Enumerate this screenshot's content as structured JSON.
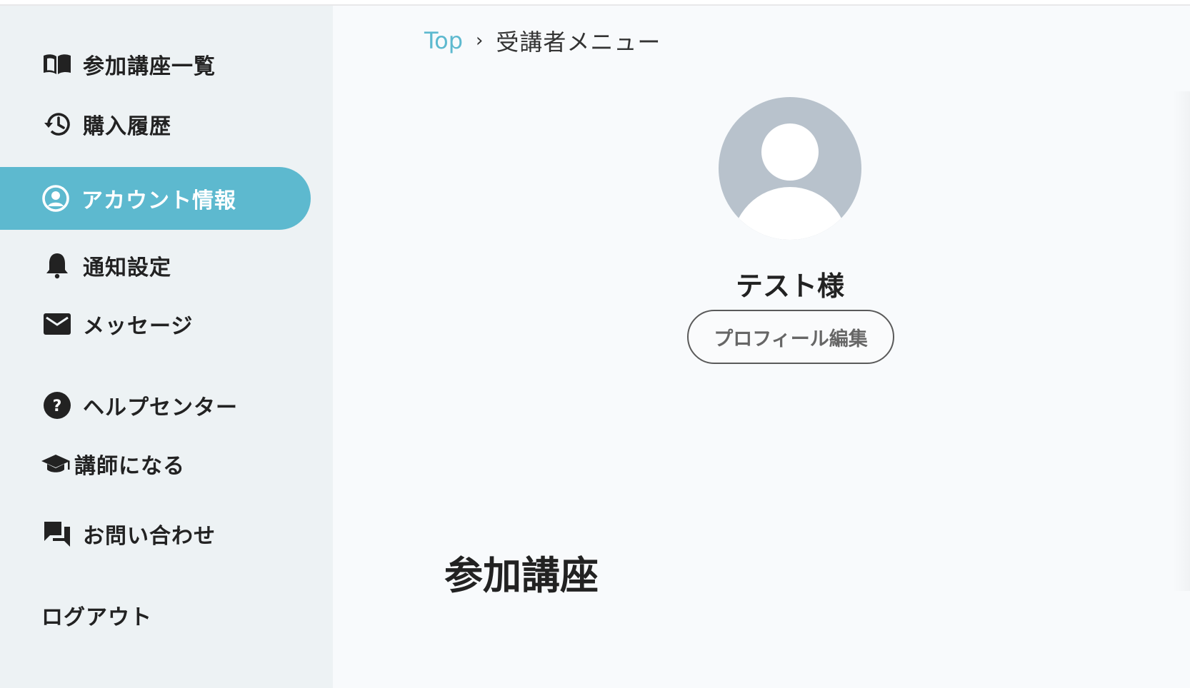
{
  "sidebar": {
    "items": [
      {
        "label": "参加講座一覧",
        "icon": "book-open-icon"
      },
      {
        "label": "購入履歴",
        "icon": "history-icon"
      },
      {
        "label": "アカウント情報",
        "icon": "account-circle-icon",
        "active": true
      },
      {
        "label": "通知設定",
        "icon": "bell-icon"
      },
      {
        "label": "メッセージ",
        "icon": "mail-icon"
      },
      {
        "label": "ヘルプセンター",
        "icon": "help-circle-icon"
      },
      {
        "label": "講師になる",
        "icon": "graduation-cap-icon"
      },
      {
        "label": "お問い合わせ",
        "icon": "chat-bubbles-icon"
      }
    ],
    "logout_label": "ログアウト"
  },
  "breadcrumb": {
    "top": "Top",
    "separator": "›",
    "current": "受講者メニュー"
  },
  "profile": {
    "name": "テスト様",
    "edit_label": "プロフィール編集"
  },
  "section": {
    "title": "参加講座"
  },
  "colors": {
    "accent": "#5db9cf",
    "sidebar_bg": "#edf2f4",
    "main_bg": "#f8fafc",
    "avatar_bg": "#b8c2cc"
  }
}
